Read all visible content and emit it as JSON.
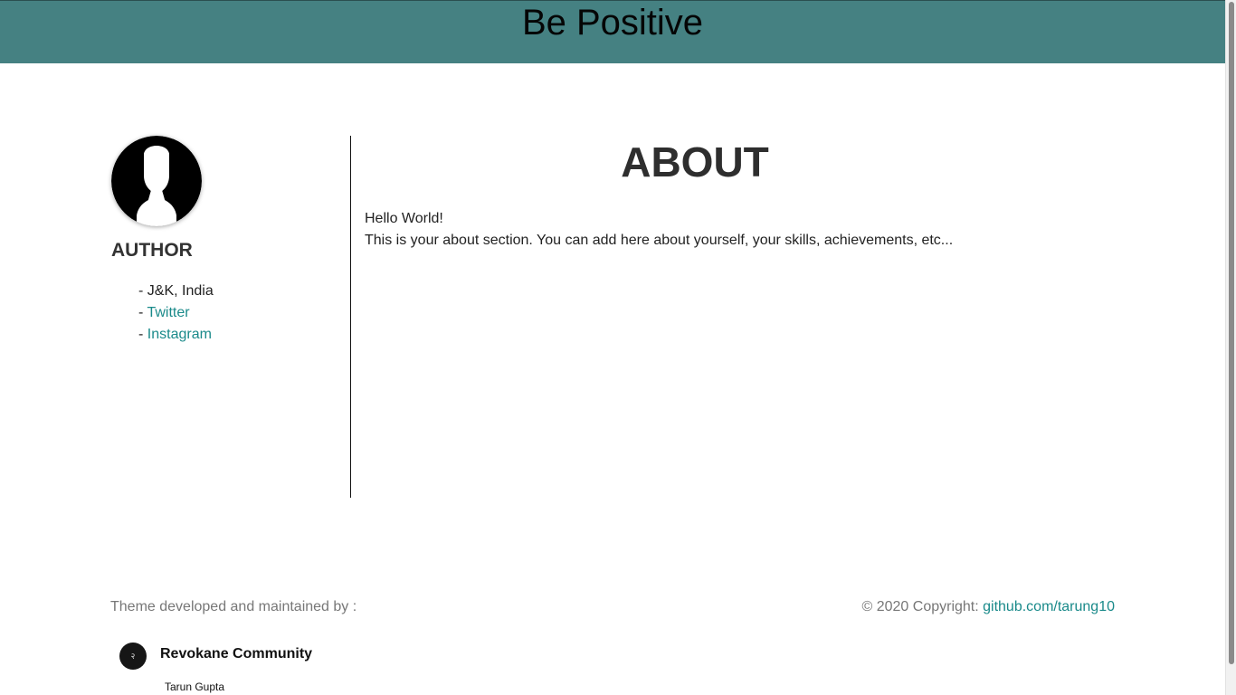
{
  "header": {
    "title": "Be Positive",
    "background": "#458182"
  },
  "sidebar": {
    "heading": "AUTHOR",
    "items": [
      {
        "prefix": "- ",
        "label": "J&K, India"
      },
      {
        "prefix": "- ",
        "label": "Twitter"
      },
      {
        "prefix": "- ",
        "label": "Instagram"
      }
    ],
    "link_color": "#1a8a8a"
  },
  "main": {
    "title": "ABOUT",
    "lines": [
      "Hello World!",
      "This is your about section. You can add here about yourself, your skills, achievements, etc..."
    ]
  },
  "footer": {
    "left_text": "Theme developed and maintained by :",
    "copyright_text": "© 2020 Copyright: ",
    "copyright_link": "github.com/tarung10",
    "community_name": "Revokane Community",
    "community_sub": "Tarun Gupta",
    "community_logo_glyph": "२"
  }
}
